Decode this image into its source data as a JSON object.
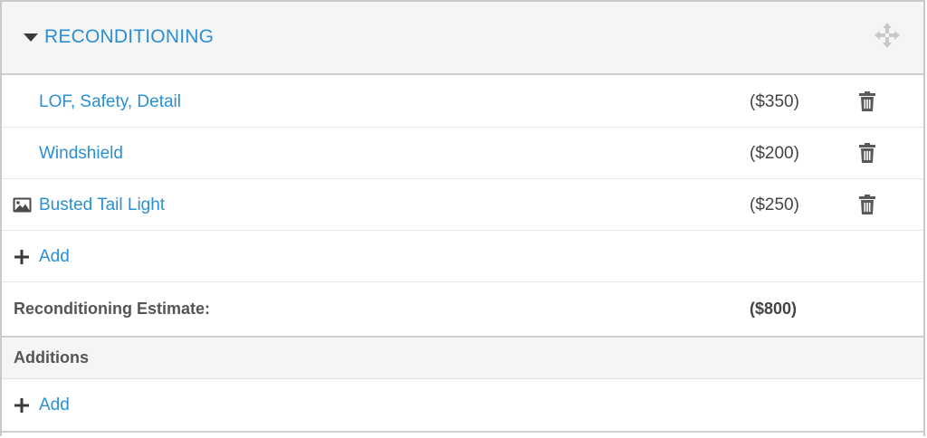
{
  "section": {
    "title": "RECONDITIONING",
    "items": [
      {
        "label": "LOF, Safety, Detail",
        "amount": "($350)",
        "has_image": false
      },
      {
        "label": "Windshield",
        "amount": "($200)",
        "has_image": false
      },
      {
        "label": "Busted Tail Light",
        "amount": "($250)",
        "has_image": true
      }
    ],
    "add_label": "Add",
    "estimate": {
      "label": "Reconditioning Estimate:",
      "amount": "($800)"
    }
  },
  "additions": {
    "title": "Additions",
    "add_label": "Add"
  },
  "colors": {
    "link": "#2a8fd4",
    "header_bg": "#f5f5f5",
    "border": "#cfcfcf"
  },
  "icons": [
    "caret-down-icon",
    "move-icon",
    "trash-icon",
    "image-icon",
    "plus-icon"
  ]
}
